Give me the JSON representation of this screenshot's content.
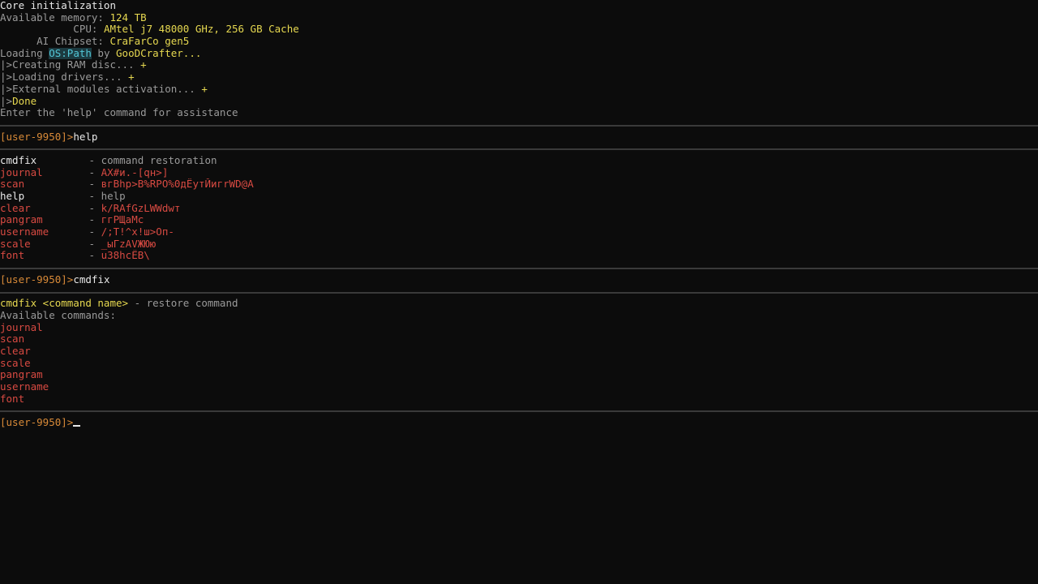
{
  "boot": {
    "title": "Core initialization",
    "memory_label": "Available memory: ",
    "memory_value": "124 TB",
    "cpu_label": "            CPU: ",
    "cpu_value": "AMtel j7 48000 GHz, 256 GB Cache",
    "chip_label": "      AI Chipset: ",
    "chip_value": "CraFarCo gen5",
    "loading_prefix": "Loading ",
    "loading_os": "OS:Path",
    "loading_by": " by ",
    "loading_author": "GooDCrafter...",
    "steps": [
      {
        "prefix": "|>",
        "text": "Creating RAM disc... ",
        "mark": "+"
      },
      {
        "prefix": "|>",
        "text": "Loading drivers... ",
        "mark": "+"
      },
      {
        "prefix": "|>",
        "text": "External modules activation... ",
        "mark": "+"
      }
    ],
    "done_prefix": "|>",
    "done_text": "Done",
    "hint": "Enter the 'help' command for assistance"
  },
  "prompt": "[user-9950]>",
  "session": [
    {
      "command": "help"
    },
    {
      "command": "cmdfix"
    }
  ],
  "help_list": [
    {
      "name": "cmdfix",
      "dash": " - ",
      "desc": "command restoration",
      "ok": true
    },
    {
      "name": "journal",
      "dash": " - ",
      "desc": "AX#и.-[qн>]",
      "ok": false
    },
    {
      "name": "scan",
      "dash": " - ",
      "desc": "вгBhp>B%RPO%0дЁутЙигrWD@A",
      "ok": false
    },
    {
      "name": "help",
      "dash": " - ",
      "desc": "help",
      "ok": true
    },
    {
      "name": "clear",
      "dash": " - ",
      "desc": "k/RAfGzLWWdwт",
      "ok": false
    },
    {
      "name": "pangram",
      "dash": " - ",
      "desc": "ггРЩaMc",
      "ok": false
    },
    {
      "name": "username",
      "dash": " - ",
      "desc": "/;T!^x!ш>Оп-",
      "ok": false
    },
    {
      "name": "scale",
      "dash": " - ",
      "desc": "_ыГzAVЖЮю",
      "ok": false
    },
    {
      "name": "font",
      "dash": " - ",
      "desc": "u38hcЁB\\",
      "ok": false
    }
  ],
  "cmdfix_output": {
    "usage_cmd": "cmdfix <command name>",
    "usage_desc": " - restore command",
    "available_label": "Available commands:",
    "commands": [
      "journal",
      "scan",
      "clear",
      "scale",
      "pangram",
      "username",
      "font"
    ]
  },
  "colors": {
    "background": "#0c0c0c",
    "prompt": "#d88a38",
    "value": "#e6d850",
    "broken": "#d84a42",
    "highlight": "#52c8d8",
    "progress_mark": "#9ec868"
  }
}
